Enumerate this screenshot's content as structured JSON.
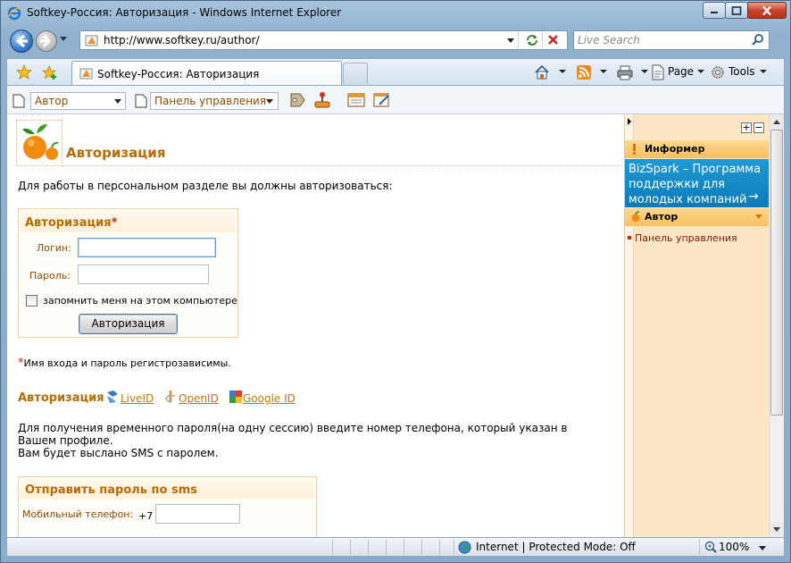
{
  "window": {
    "title": "Softkey-Россия: Авторизация - Windows Internet Explorer"
  },
  "address_bar": {
    "url": "http://www.softkey.ru/author/",
    "search_placeholder": "Live Search"
  },
  "tabs": [
    {
      "label": "Softkey-Россия: Авторизация",
      "active": true
    }
  ],
  "command_bar": {
    "page_label": "Page",
    "tools_label": "Tools"
  },
  "links_bar": {
    "combo1": "Автор",
    "combo2": "Панель управления"
  },
  "content": {
    "page_title": "Авторизация",
    "intro": "Для работы в персональном разделе вы должны авторизоваться:",
    "auth_form": {
      "title": "Авторизация",
      "required_mark": "*",
      "login_label": "Логин:",
      "login_value": "",
      "password_label": "Пароль:",
      "password_value": "",
      "remember_label": "запомнить меня на этом компьютере",
      "remember_checked": false,
      "submit_label": "Авторизация"
    },
    "note_star": "*",
    "note": "Имя входа и пароль регистрозависимы.",
    "external_auth": {
      "title": "Авторизация",
      "links": [
        "LiveID",
        "OpenID",
        "Google ID"
      ]
    },
    "sms_info": [
      "Для получения временного пароля(на одну сессию) введите номер телефона, который указан в",
      "Вашем профиле.",
      "Вам будет выслано SMS с паролем."
    ],
    "sms_form": {
      "title": "Отправить пароль по sms",
      "phone_label": "Мобильный телефон:",
      "phone_prefix": "+7",
      "phone_value": ""
    }
  },
  "sidebar": {
    "informer_title": "Информер",
    "banner_text": "BizSpark – Программа поддержки для молодых компаний",
    "banner_arrow": "→",
    "author_title": "Автор",
    "links": [
      "Панель управления"
    ]
  },
  "status_bar": {
    "zone": "Internet | Protected Mode: Off",
    "zoom": "100%"
  },
  "colors": {
    "accent": "#b86b00",
    "link": "#c87800",
    "banner": "#1f9ad4",
    "sidebar_bg": "#fde6c6"
  }
}
